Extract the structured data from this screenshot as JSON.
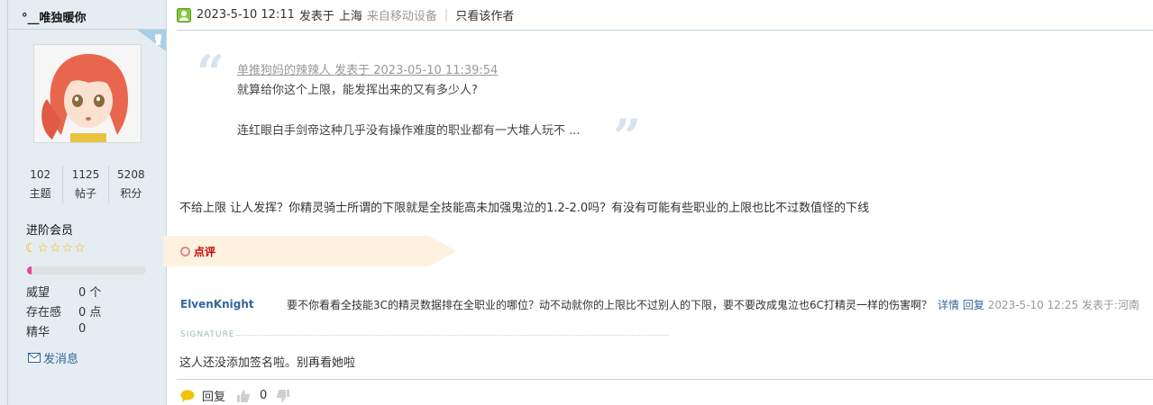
{
  "profile": {
    "username": "°__唯独暖你",
    "stats": [
      {
        "value": "102",
        "label": "主题"
      },
      {
        "value": "1125",
        "label": "帖子"
      },
      {
        "value": "5208",
        "label": "积分"
      }
    ],
    "rank": "进阶会员",
    "stars": "☾☆☆☆☆",
    "level_progress": 0.04,
    "props": [
      {
        "label": "威望",
        "value": "0 个"
      },
      {
        "label": "存在感",
        "value": "0 点"
      },
      {
        "label": "精华",
        "value": "0"
      }
    ],
    "message_label": "发消息"
  },
  "post_header": {
    "datetime": "2023-5-10 12:11",
    "posted_at": "发表于",
    "location": "上海",
    "device": "来自移动设备",
    "author_only": "只看该作者"
  },
  "quote": {
    "head": "单推狗妈的辣辣人 发表于 2023-05-10 11:39:54",
    "line1": "就算给你这个上限，能发挥出来的又有多少人?",
    "line2": "连红眼白手剑帝这种几乎没有操作难度的职业都有一大堆人玩不 ..."
  },
  "body": "不给上限 让人发挥？你精灵骑士所谓的下限就是全技能高未加强鬼泣的1.2-2.0吗？有没有可能有些职业的上限也比不过数值怪的下线",
  "rate_label": "点评",
  "comment": {
    "user": "ElvenKnight",
    "text": "要不你看看全技能3C的精灵数据排在全职业的哪位？动不动就你的上限比不过别人的下限，要不要改成鬼泣也6C打精灵一样的伤害啊？",
    "detail": "详情",
    "reply": "回复",
    "date": "2023-5-10 12:25 发表于:河南"
  },
  "signature": {
    "label": "SIGNATURE",
    "text": "这人还没添加签名啦。别再看她啦"
  },
  "actions": {
    "reply": "回复",
    "like_count": "0"
  },
  "colors": {
    "sidebar_bg": "#e5edf2",
    "border": "#c2d5e3",
    "link": "#336699",
    "progress": "#e64799",
    "star": "#f5b301",
    "rate_bg": "#fdf1e0"
  }
}
